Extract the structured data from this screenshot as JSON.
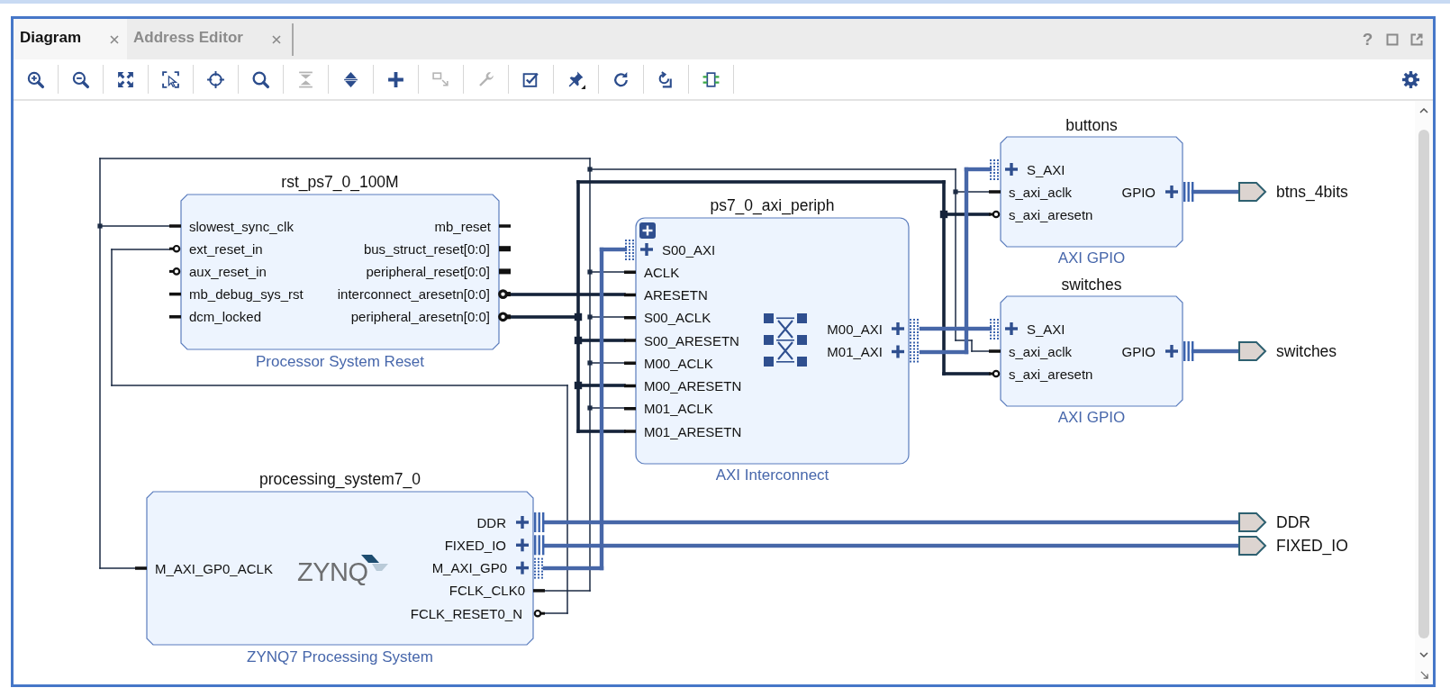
{
  "tabs": [
    {
      "label": "Diagram",
      "selected": true
    },
    {
      "label": "Address Editor",
      "selected": false
    }
  ],
  "window_controls": {
    "help": "?"
  },
  "toolbar": [
    {
      "disabled": false
    },
    {
      "disabled": false
    },
    {
      "disabled": false
    },
    {
      "disabled": false
    },
    {
      "disabled": false
    },
    {
      "disabled": false
    },
    {
      "disabled": true
    },
    {
      "disabled": false
    },
    {
      "disabled": false
    },
    {
      "disabled": true
    },
    {
      "disabled": true
    },
    {
      "disabled": false
    },
    {
      "disabled": false
    },
    {
      "disabled": false
    },
    {
      "disabled": false
    },
    {
      "disabled": false
    }
  ],
  "diagram": {
    "blocks": [
      {
        "kind": "reset",
        "name": "rst_ps7_0_100M",
        "type": "Processor System Reset",
        "expandable": false,
        "inputs": [
          {
            "label": "slowest_sync_clk",
            "kind": "plain"
          },
          {
            "label": "ext_reset_in",
            "kind": "inverted"
          },
          {
            "label": "aux_reset_in",
            "kind": "inverted"
          },
          {
            "label": "mb_debug_sys_rst",
            "kind": "plain"
          },
          {
            "label": "dcm_locked",
            "kind": "plain"
          }
        ],
        "outputs": [
          {
            "label": "mb_reset",
            "kind": "plain"
          },
          {
            "label": "bus_struct_reset[0:0]",
            "kind": "bus"
          },
          {
            "label": "peripheral_reset[0:0]",
            "kind": "bus"
          },
          {
            "label": "interconnect_aresetn[0:0]",
            "kind": "invbus"
          },
          {
            "label": "peripheral_aresetn[0:0]",
            "kind": "invbus"
          }
        ]
      },
      {
        "kind": "interconnect",
        "name": "ps7_0_axi_periph",
        "type": "AXI Interconnect",
        "expandable": true,
        "inputs": [
          {
            "label": "S00_AXI",
            "kind": "axi"
          },
          {
            "label": "ACLK",
            "kind": "plain"
          },
          {
            "label": "ARESETN",
            "kind": "plain"
          },
          {
            "label": "S00_ACLK",
            "kind": "plain"
          },
          {
            "label": "S00_ARESETN",
            "kind": "plain"
          },
          {
            "label": "M00_ACLK",
            "kind": "plain"
          },
          {
            "label": "M00_ARESETN",
            "kind": "plain"
          },
          {
            "label": "M01_ACLK",
            "kind": "plain"
          },
          {
            "label": "M01_ARESETN",
            "kind": "plain"
          }
        ],
        "outputs": [
          {
            "label": "M00_AXI",
            "kind": "axi"
          },
          {
            "label": "M01_AXI",
            "kind": "axi"
          }
        ]
      },
      {
        "kind": "gpio",
        "name": "buttons",
        "type": "AXI GPIO",
        "expandable": false,
        "inputs": [
          {
            "label": "S_AXI",
            "kind": "axi"
          },
          {
            "label": "s_axi_aclk",
            "kind": "plain"
          },
          {
            "label": "s_axi_aresetn",
            "kind": "inverted"
          }
        ],
        "outputs": [
          {
            "label": "GPIO",
            "kind": "io"
          }
        ]
      },
      {
        "kind": "gpio",
        "name": "switches",
        "type": "AXI GPIO",
        "expandable": false,
        "inputs": [
          {
            "label": "S_AXI",
            "kind": "axi"
          },
          {
            "label": "s_axi_aclk",
            "kind": "plain"
          },
          {
            "label": "s_axi_aresetn",
            "kind": "inverted"
          }
        ],
        "outputs": [
          {
            "label": "GPIO",
            "kind": "io"
          }
        ]
      },
      {
        "kind": "zynq",
        "name": "processing_system7_0",
        "type": "ZYNQ7 Processing System",
        "logo": "ZYNQ",
        "expandable": false,
        "inputs": [
          {
            "label": "M_AXI_GP0_ACLK",
            "kind": "plain"
          }
        ],
        "outputs": [
          {
            "label": "DDR",
            "kind": "io"
          },
          {
            "label": "FIXED_IO",
            "kind": "io"
          },
          {
            "label": "M_AXI_GP0",
            "kind": "axi"
          },
          {
            "label": "FCLK_CLK0",
            "kind": "plain"
          },
          {
            "label": "FCLK_RESET0_N",
            "kind": "inverted"
          }
        ]
      }
    ],
    "ports": [
      {
        "label": "btns_4bits"
      },
      {
        "label": "switches"
      },
      {
        "label": "DDR"
      },
      {
        "label": "FIXED_IO"
      }
    ]
  }
}
